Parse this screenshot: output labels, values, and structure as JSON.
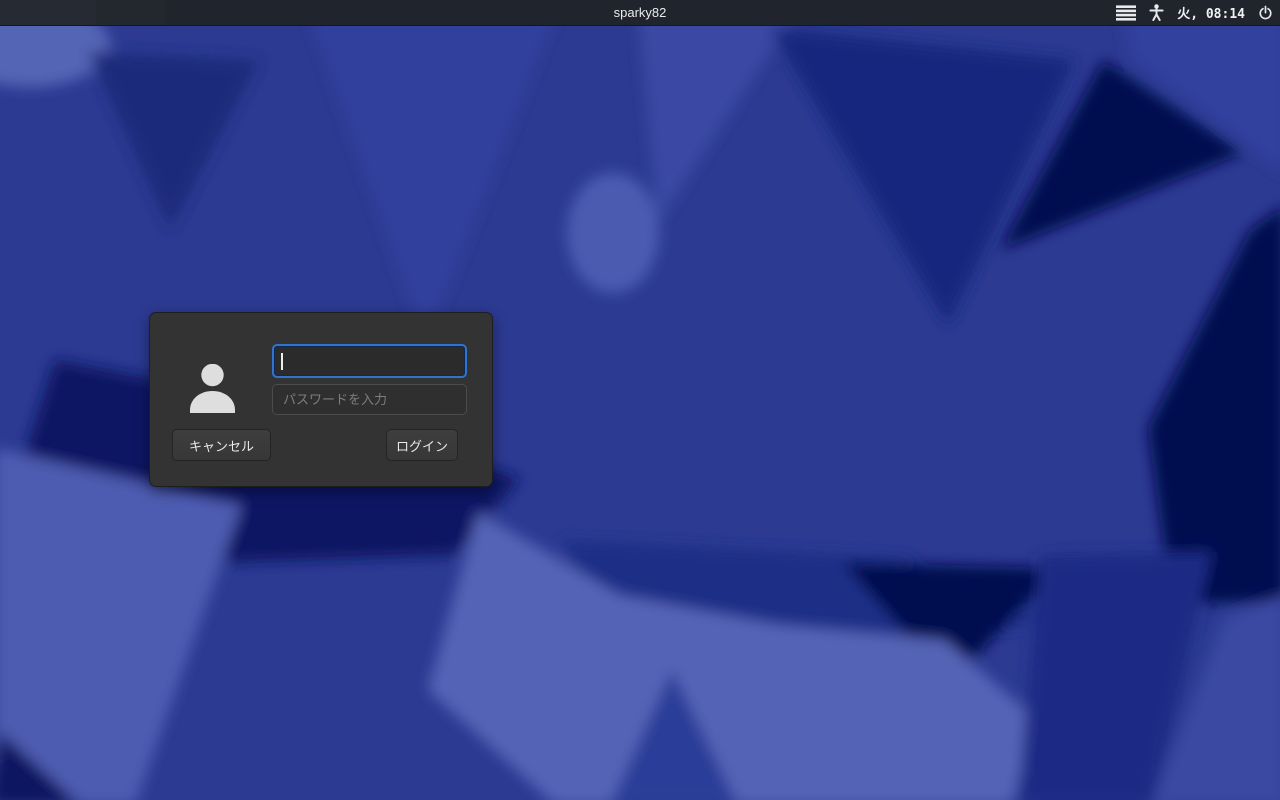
{
  "topbar": {
    "hostname": "sparky82",
    "clock": "火, 08:14",
    "menu_icon": "menu-icon",
    "accessibility_icon": "accessibility-icon",
    "power_icon": "power-icon"
  },
  "login_dialog": {
    "avatar_icon": "user-avatar-icon",
    "username_value": "",
    "password_placeholder": "パスワードを入力",
    "buttons": {
      "cancel": "キャンセル",
      "login": "ログイン"
    }
  },
  "colors": {
    "topbar_bg": "#20242c",
    "topbar_text": "#e9ebee",
    "wallpaper_base": "#2c3a92",
    "wallpaper_dark_navy": "#050e4f",
    "wallpaper_mid_dark": "#16267e",
    "wallpaper_light_periwinkle": "#5564b6",
    "dialog_bg": "#333333",
    "entry_bg": "#2b2b2b",
    "focus_border_blue": "#3173ce",
    "button_bg": "#3a3a3a",
    "button_text": "#e9e9e9",
    "placeholder_text": "#7d7d7d",
    "avatar_fill": "#dedede"
  }
}
